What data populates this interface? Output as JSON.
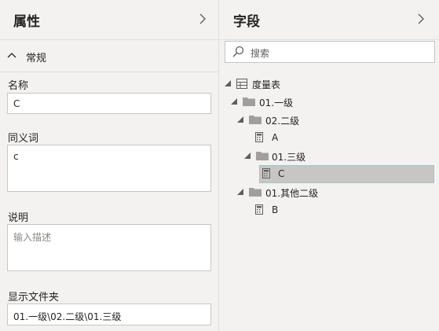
{
  "properties": {
    "title": "属性",
    "section_label": "常规",
    "name_label": "名称",
    "name_value": "C",
    "synonyms_label": "同义词",
    "synonyms_value": "c",
    "description_label": "说明",
    "description_placeholder": "输入描述",
    "display_folder_label": "显示文件夹",
    "display_folder_value": "01.一级\\02.二级\\01.三级"
  },
  "fields": {
    "title": "字段",
    "search_placeholder": "搜索",
    "tree": {
      "table": "度量表",
      "folder_level1": "01.一级",
      "folder_level2": "02.二级",
      "measure_a": "A",
      "folder_level3": "01.三级",
      "measure_c": "C",
      "folder_other": "01.其他二级",
      "measure_b": "B"
    }
  },
  "colors": {
    "background": "#f3f2f1",
    "selection": "#c8c6c4",
    "selection_border": "#9fc6d0",
    "folder": "#a19f9d"
  }
}
